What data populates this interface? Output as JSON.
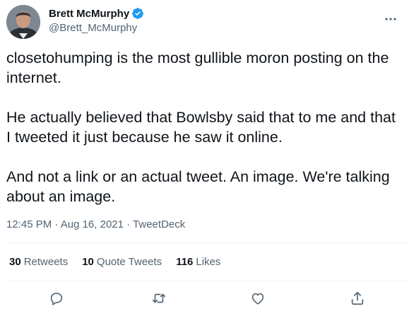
{
  "author": {
    "display_name": "Brett McMurphy",
    "handle": "@Brett_McMurphy",
    "verified": true
  },
  "tweet": {
    "text": "closetohumping is the most gullible moron posting on the internet.\n\nHe actually believed that Bowlsby said that to me and that I tweeted it just because he saw it online.\n\nAnd not a link or an actual tweet. An image. We're talking about an image.",
    "time": "12:45 PM",
    "date": "Aug 16, 2021",
    "source": "TweetDeck",
    "separator": " · "
  },
  "stats": {
    "retweets_count": "30",
    "retweets_label": "Retweets",
    "quote_count": "10",
    "quote_label": "Quote Tweets",
    "likes_count": "116",
    "likes_label": "Likes"
  },
  "icons": {
    "more": "more-horizontal-icon",
    "reply": "reply-icon",
    "retweet": "retweet-icon",
    "like": "heart-icon",
    "share": "share-icon",
    "verified": "verified-badge-icon"
  },
  "colors": {
    "text_primary": "#0f1419",
    "text_secondary": "#536471",
    "verified_blue": "#1d9bf0",
    "divider": "#eff3f4"
  }
}
